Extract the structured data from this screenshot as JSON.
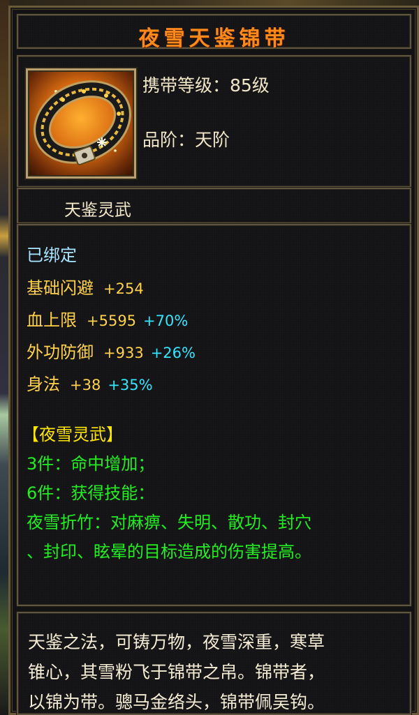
{
  "item": {
    "name": "夜雪天鉴锦带",
    "level_text": "携带等级：85级",
    "grade_text": "品阶：天阶",
    "type_label": "天鉴灵武",
    "bound_status": "已绑定",
    "icon": "golden-belt-icon"
  },
  "attributes": [
    {
      "label": "基础闪避",
      "value": "+254",
      "bonus": ""
    },
    {
      "label": "血上限",
      "value": "+5595",
      "bonus": "+70%"
    },
    {
      "label": "外功防御",
      "value": "+933",
      "bonus": "+26%"
    },
    {
      "label": "身法",
      "value": "+38",
      "bonus": "+35%"
    }
  ],
  "set": {
    "title": "【夜雪灵武】",
    "line1": "3件：命中增加；",
    "line2": "6件：获得技能：",
    "line3": "夜雪折竹：对麻痹、失明、散功、封穴",
    "line4": "、封印、眩晕的目标造成的伤害提高。"
  },
  "description": {
    "line1": "天鉴之法，可铸万物，夜雪深重，寒草",
    "line2": "锥心，其雪粉飞于锦带之帛。锦带者，",
    "line3": "以锦为带。骢马金络头，锦带佩吴钩。"
  },
  "colors": {
    "title": "#ff8a1a",
    "stat": "#ffd24a",
    "bonus": "#33e6ff",
    "set_text": "#22ee22",
    "set_title": "#ffe600",
    "bound": "#a8e6ff",
    "frame": "#5f5540"
  }
}
